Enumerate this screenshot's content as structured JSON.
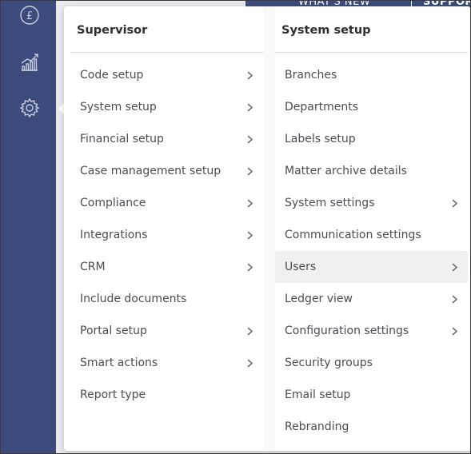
{
  "top_bar": {
    "whats_new_label": "WHAT'S NEW",
    "support_label": "SUPPORT"
  },
  "nav_rail": {
    "icons": [
      "pound-icon",
      "chart-icon",
      "gear-icon"
    ]
  },
  "supervisor": {
    "heading": "Supervisor",
    "items": [
      {
        "label": "Code setup",
        "has_submenu": true
      },
      {
        "label": "System setup",
        "has_submenu": true
      },
      {
        "label": "Financial setup",
        "has_submenu": true
      },
      {
        "label": "Case management setup",
        "has_submenu": true
      },
      {
        "label": "Compliance",
        "has_submenu": true
      },
      {
        "label": "Integrations",
        "has_submenu": true
      },
      {
        "label": "CRM",
        "has_submenu": true
      },
      {
        "label": "Include documents",
        "has_submenu": false
      },
      {
        "label": "Portal setup",
        "has_submenu": true
      },
      {
        "label": "Smart actions",
        "has_submenu": true
      },
      {
        "label": "Report type",
        "has_submenu": false
      }
    ]
  },
  "system_setup": {
    "heading": "System setup",
    "items": [
      {
        "label": "Branches",
        "has_submenu": false
      },
      {
        "label": "Departments",
        "has_submenu": false
      },
      {
        "label": "Labels setup",
        "has_submenu": false
      },
      {
        "label": "Matter archive details",
        "has_submenu": false
      },
      {
        "label": "System settings",
        "has_submenu": true
      },
      {
        "label": "Communication settings",
        "has_submenu": false
      },
      {
        "label": "Users",
        "has_submenu": true,
        "active": true
      },
      {
        "label": "Ledger view",
        "has_submenu": true
      },
      {
        "label": "Configuration settings",
        "has_submenu": true
      },
      {
        "label": "Security groups",
        "has_submenu": false
      },
      {
        "label": "Email setup",
        "has_submenu": false
      },
      {
        "label": "Rebranding",
        "has_submenu": false
      }
    ]
  },
  "colors": {
    "rail": "#3d4b7c",
    "text": "#4a4c52",
    "heading": "#2d2f33",
    "active_row": "#f0f0f2"
  }
}
